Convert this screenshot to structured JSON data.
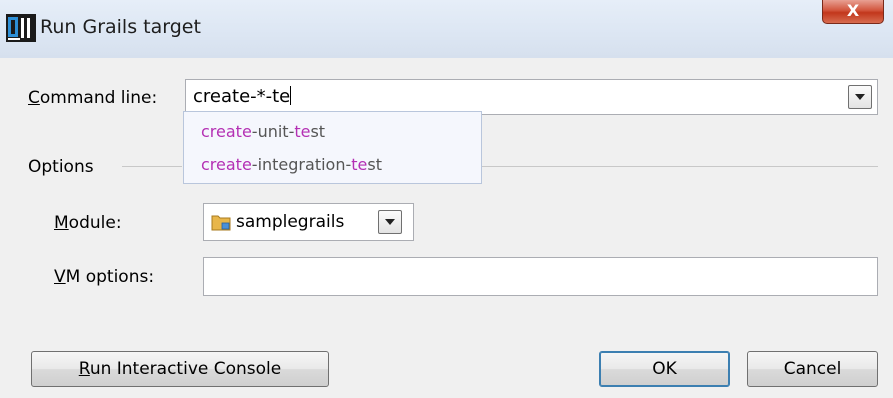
{
  "window": {
    "title": "Run Grails target",
    "close_glyph": "X"
  },
  "command_line": {
    "label_mnemonic": "C",
    "label_rest": "ommand line:",
    "value": "create-*-te"
  },
  "suggestions": [
    {
      "parts": [
        {
          "text": "create",
          "hl": true
        },
        {
          "text": "-unit-",
          "hl": false
        },
        {
          "text": "te",
          "hl": true
        },
        {
          "text": "st",
          "hl": false
        }
      ]
    },
    {
      "parts": [
        {
          "text": "create",
          "hl": true
        },
        {
          "text": "-integration-",
          "hl": false
        },
        {
          "text": "te",
          "hl": true
        },
        {
          "text": "st",
          "hl": false
        }
      ]
    }
  ],
  "options": {
    "label": "Options"
  },
  "module": {
    "label_mnemonic": "M",
    "label_rest": "odule:",
    "value": "samplegrails"
  },
  "vm_options": {
    "label_mnemonic": "V",
    "label_rest": "M options:",
    "value": ""
  },
  "buttons": {
    "console_mnemonic": "R",
    "console_rest": "un Interactive Console",
    "ok": "OK",
    "cancel": "Cancel"
  },
  "colors": {
    "match_highlight": "#b430b4",
    "close_button": "#c2371c"
  },
  "icons": {
    "app": "intellij-idea-icon",
    "module": "module-folder-icon",
    "dropdown": "chevron-down-icon"
  }
}
